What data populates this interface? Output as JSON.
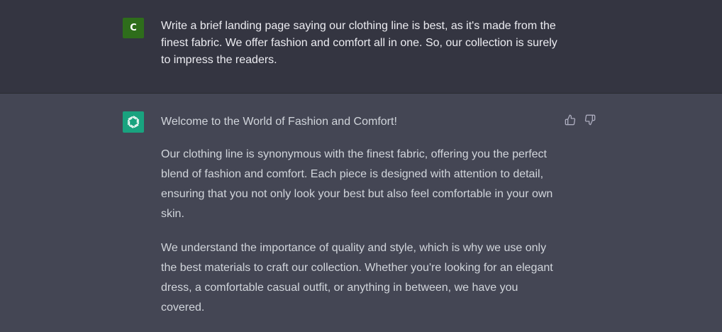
{
  "user_message": {
    "avatar_letter": "C",
    "avatar_color": "#2e6d1b",
    "text": "Write a brief landing page saying our clothing line is best, as it's made from the finest fabric. We offer fashion and comfort all in one. So, our collection is surely to impress the readers."
  },
  "assistant_message": {
    "avatar_icon": "openai-logo-icon",
    "avatar_color": "#19a37f",
    "heading": "Welcome to the World of Fashion and Comfort!",
    "paragraphs": [
      "Our clothing line is synonymous with the finest fabric, offering you the perfect blend of fashion and comfort. Each piece is designed with attention to detail, ensuring that you not only look your best but also feel comfortable in your own skin.",
      "We understand the importance of quality and style, which is why we use only the best materials to craft our collection. Whether you're looking for an elegant dress, a comfortable casual outfit, or anything in between, we have you covered."
    ],
    "feedback_icons": [
      "thumbs-up-icon",
      "thumbs-down-icon"
    ]
  }
}
